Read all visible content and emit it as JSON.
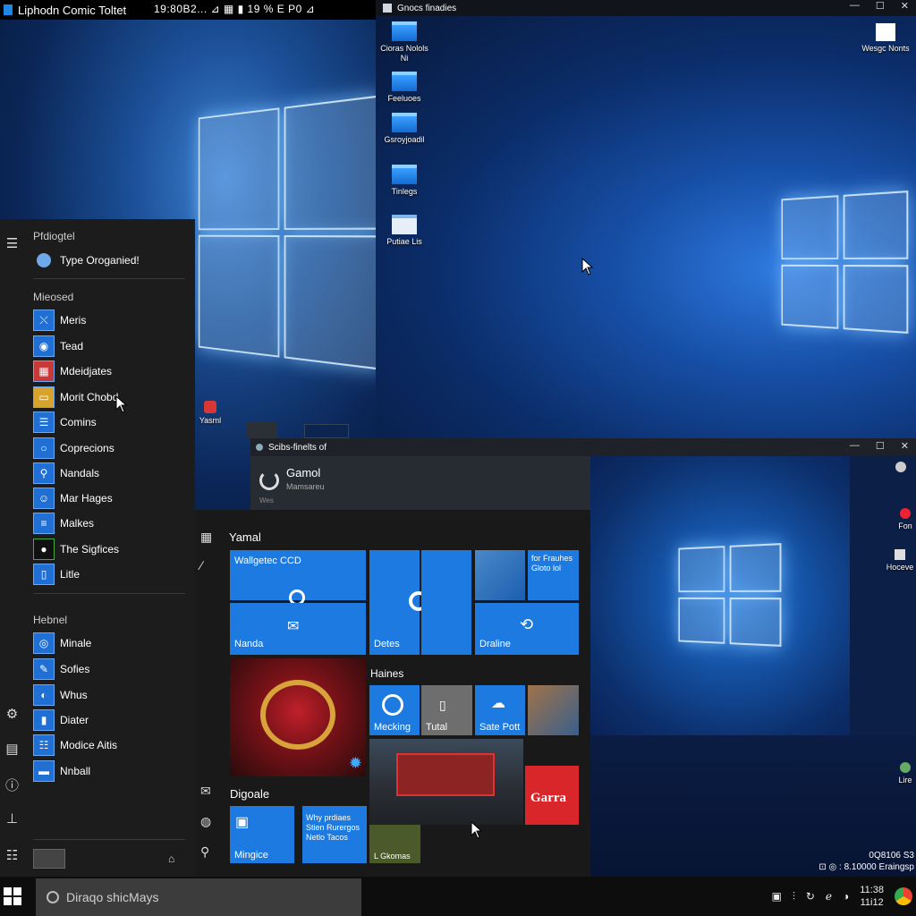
{
  "top_bar": {
    "title": "Liphodn Comic Toltet",
    "status": "19:80B2... ⊿ ▦ ▮ 19 % E P0 ⊿"
  },
  "right_window": {
    "title": "Gnocs finadies",
    "desktop_icons": [
      {
        "label": "Cioras Nolols Ni"
      },
      {
        "label": "Feeluoes"
      },
      {
        "label": "Gsroyjoadil"
      },
      {
        "label": "Tinlegs"
      },
      {
        "label": "Putiae Lis"
      }
    ],
    "corner_icon": "Wesgc Nonts"
  },
  "left_desktop_icon": "Yasml",
  "middle_window": {
    "title": "Scibs-finelts of",
    "app_name": "Gamol",
    "app_sub": "Mamsareu",
    "app_sub2": "Wes"
  },
  "side_icons": [
    {
      "label": "Fon"
    },
    {
      "label": "Hoceve"
    },
    {
      "label": "Lire"
    }
  ],
  "start_menu": {
    "header": "Pfdiogtel",
    "search_item": "Type Oroganied!",
    "section1": "Mieosed",
    "items1": [
      "Meris",
      "Tead",
      "Mdeidjates",
      "Morit Chobd",
      "Comins",
      "Coprecions",
      "Nandals",
      "Mar Hages",
      "Malkes",
      "The Sigfices",
      "Litle"
    ],
    "section2": "Hebnel",
    "items2": [
      "Minale",
      "Sofies",
      "Whus",
      "Diater",
      "Modice Aitis",
      "Nnball"
    ]
  },
  "tile_panel": {
    "section1": "Yamal",
    "tiles1": {
      "t1": "Wallgetec CCD",
      "t2": "Nanda",
      "t3": "Detes",
      "t4": "Draline",
      "t5": "for Frauhes Gloto lol"
    },
    "section2": "Haines",
    "tiles2": {
      "t1": "Mecking",
      "t2": "Tutal",
      "t3": "Sate Pott",
      "t4": "Garra"
    },
    "section3": "Digoale",
    "tiles3": {
      "t1": "Mingice",
      "t2": "Why prdiaes Stien Rurergos Netlo Tacos",
      "t3": "L Gkomas"
    }
  },
  "taskbar": {
    "search_placeholder": "Diraqo shicMays",
    "time": "11:38",
    "date": "11i12",
    "notice_line1": "0Q8106 S3",
    "notice_line2": "⊡ ◎ : 8.10000 Eraingsp"
  },
  "colors": {
    "accent": "#1c7ae0",
    "start_bg": "#1c1c1c",
    "taskbar_bg": "#0d0d0d"
  }
}
